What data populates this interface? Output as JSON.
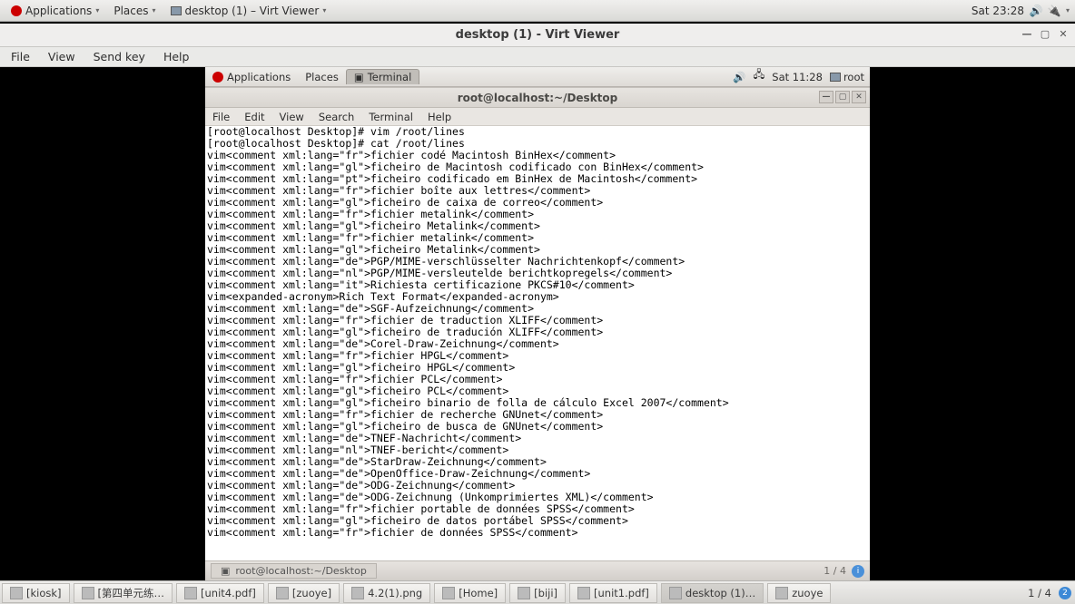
{
  "outer_topbar": {
    "applications": "Applications",
    "places": "Places",
    "active_app": "desktop (1) – Virt Viewer",
    "clock": "Sat 23:28"
  },
  "virt_viewer": {
    "title": "desktop (1) - Virt Viewer",
    "menu": [
      "File",
      "View",
      "Send key",
      "Help"
    ]
  },
  "guest_topbar": {
    "applications": "Applications",
    "places": "Places",
    "tab": "Terminal",
    "clock": "Sat 11:28",
    "user": "root"
  },
  "terminal": {
    "title": "root@localhost:~/Desktop",
    "menu": [
      "File",
      "Edit",
      "View",
      "Search",
      "Terminal",
      "Help"
    ],
    "footer_tab": "root@localhost:~/Desktop",
    "footer_ws": "1 / 4",
    "lines": [
      "[root@localhost Desktop]# vim /root/lines",
      "[root@localhost Desktop]# cat /root/lines",
      "vim<comment xml:lang=\"fr\">fichier codé Macintosh BinHex</comment>",
      "vim<comment xml:lang=\"gl\">ficheiro de Macintosh codificado con BinHex</comment>",
      "vim<comment xml:lang=\"pt\">ficheiro codificado em BinHex de Macintosh</comment>",
      "vim<comment xml:lang=\"fr\">fichier boîte aux lettres</comment>",
      "vim<comment xml:lang=\"gl\">ficheiro de caixa de correo</comment>",
      "vim<comment xml:lang=\"fr\">fichier metalink</comment>",
      "vim<comment xml:lang=\"gl\">ficheiro Metalink</comment>",
      "vim<comment xml:lang=\"fr\">fichier metalink</comment>",
      "vim<comment xml:lang=\"gl\">ficheiro Metalink</comment>",
      "vim<comment xml:lang=\"de\">PGP/MIME-verschlüsselter Nachrichtenkopf</comment>",
      "vim<comment xml:lang=\"nl\">PGP/MIME-versleutelde berichtkopregels</comment>",
      "vim<comment xml:lang=\"it\">Richiesta certificazione PKCS#10</comment>",
      "vim<expanded-acronym>Rich Text Format</expanded-acronym>",
      "vim<comment xml:lang=\"de\">SGF-Aufzeichnung</comment>",
      "vim<comment xml:lang=\"fr\">fichier de traduction XLIFF</comment>",
      "vim<comment xml:lang=\"gl\">ficheiro de tradución XLIFF</comment>",
      "vim<comment xml:lang=\"de\">Corel-Draw-Zeichnung</comment>",
      "vim<comment xml:lang=\"fr\">fichier HPGL</comment>",
      "vim<comment xml:lang=\"gl\">ficheiro HPGL</comment>",
      "vim<comment xml:lang=\"fr\">fichier PCL</comment>",
      "vim<comment xml:lang=\"gl\">ficheiro PCL</comment>",
      "vim<comment xml:lang=\"gl\">ficheiro binario de folla de cálculo Excel 2007</comment>",
      "vim<comment xml:lang=\"fr\">fichier de recherche GNUnet</comment>",
      "vim<comment xml:lang=\"gl\">ficheiro de busca de GNUnet</comment>",
      "vim<comment xml:lang=\"de\">TNEF-Nachricht</comment>",
      "vim<comment xml:lang=\"nl\">TNEF-bericht</comment>",
      "vim<comment xml:lang=\"de\">StarDraw-Zeichnung</comment>",
      "vim<comment xml:lang=\"de\">OpenOffice-Draw-Zeichnung</comment>",
      "vim<comment xml:lang=\"de\">ODG-Zeichnung</comment>",
      "vim<comment xml:lang=\"de\">ODG-Zeichnung (Unkomprimiertes XML)</comment>",
      "vim<comment xml:lang=\"fr\">fichier portable de données SPSS</comment>",
      "vim<comment xml:lang=\"gl\">ficheiro de datos portábel SPSS</comment>",
      "vim<comment xml:lang=\"fr\">fichier de données SPSS</comment>"
    ]
  },
  "taskbar": {
    "items": [
      {
        "label": "[kiosk]"
      },
      {
        "label": "[第四单元练…"
      },
      {
        "label": "[unit4.pdf]"
      },
      {
        "label": "[zuoye]"
      },
      {
        "label": "4.2(1).png"
      },
      {
        "label": "[Home]"
      },
      {
        "label": "[biji]"
      },
      {
        "label": "[unit1.pdf]"
      },
      {
        "label": "desktop (1)…",
        "active": true
      },
      {
        "label": "zuoye"
      }
    ],
    "workspace": "1 / 4",
    "notify": "2"
  }
}
